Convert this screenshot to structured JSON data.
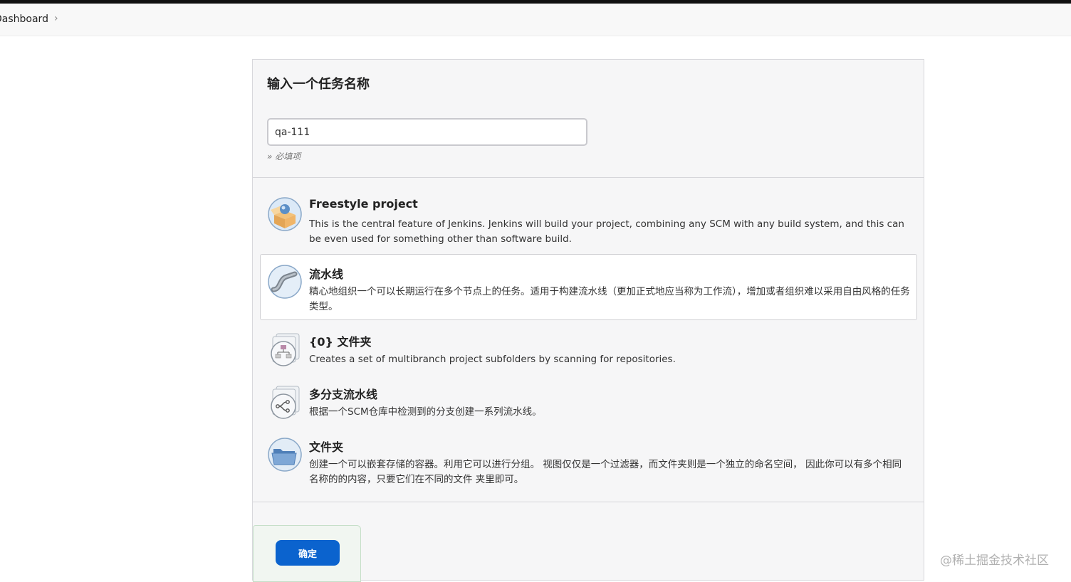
{
  "breadcrumb": {
    "root": "Dashboard",
    "separator": "›"
  },
  "form": {
    "title": "输入一个任务名称",
    "name_value": "qa-111",
    "required_note": "» 必填项"
  },
  "item_types": [
    {
      "icon": "freestyle-project-icon",
      "label": "Freestyle project",
      "description": "This is the central feature of Jenkins. Jenkins will build your project, combining any SCM with any build system, and this can be even used for something other than software build.",
      "selected": false
    },
    {
      "icon": "pipeline-icon",
      "label": "流水线",
      "description": "精心地组织一个可以长期运行在多个节点上的任务。适用于构建流水线（更加正式地应当称为工作流），增加或者组织难以采用自由风格的任务类型。",
      "selected": true
    },
    {
      "icon": "organization-folder-icon",
      "label": "{0} 文件夹",
      "description": "Creates a set of multibranch project subfolders by scanning for repositories.",
      "selected": false
    },
    {
      "icon": "multibranch-pipeline-icon",
      "label": "多分支流水线",
      "description": "根据一个SCM仓库中检测到的分支创建一系列流水线。",
      "selected": false
    },
    {
      "icon": "folder-icon",
      "label": "文件夹",
      "description": "创建一个可以嵌套存储的容器。利用它可以进行分组。 视图仅仅是一个过滤器，而文件夹则是一个独立的命名空间， 因此你可以有多个相同名称的的内容，只要它们在不同的文件 夹里即可。",
      "selected": false
    }
  ],
  "ok_label": "确定",
  "watermark": "@稀土掘金技术社区"
}
